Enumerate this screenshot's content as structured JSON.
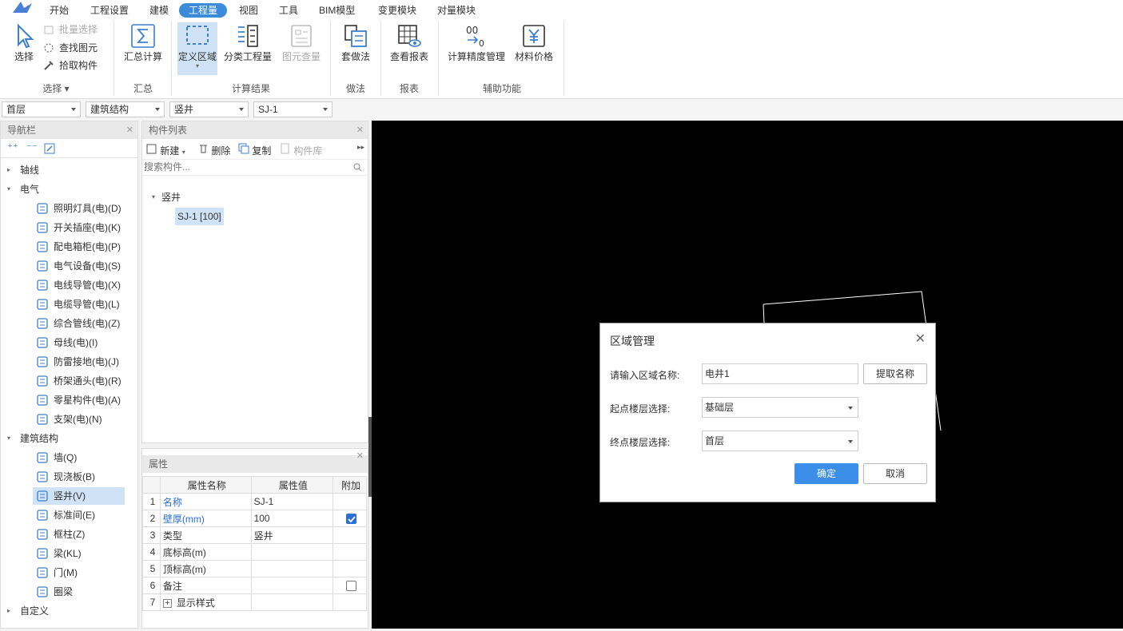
{
  "menu": {
    "items": [
      "开始",
      "工程设置",
      "建模",
      "工程量",
      "视图",
      "工具",
      "BIM模型",
      "变更模块",
      "对量模块"
    ],
    "active_index": 3
  },
  "ribbon": {
    "select": "选择",
    "batch_select": "批量选择",
    "find_element": "查找图元",
    "pick_component": "拾取构件",
    "sum_calc": "汇总计算",
    "define_region": "定义区域",
    "category_qty": "分类工程量",
    "element_qty": "图元查量",
    "apply_method": "套做法",
    "view_report": "查看报表",
    "precision_mgmt": "计算精度管理",
    "material_price": "材料价格",
    "groups": {
      "select": "选择",
      "summary": "汇总",
      "calc_result": "计算结果",
      "method": "做法",
      "report": "报表",
      "aux": "辅助功能"
    }
  },
  "combos": {
    "floor": "首层",
    "category": "建筑结构",
    "type": "竖井",
    "component": "SJ-1"
  },
  "nav": {
    "title": "导航栏",
    "items": [
      {
        "label": "轴线",
        "level": 0,
        "expanded": false
      },
      {
        "label": "电气",
        "level": 0,
        "expanded": true
      },
      {
        "label": "照明灯具(电)(D)",
        "level": 1
      },
      {
        "label": "开关插座(电)(K)",
        "level": 1
      },
      {
        "label": "配电箱柜(电)(P)",
        "level": 1
      },
      {
        "label": "电气设备(电)(S)",
        "level": 1
      },
      {
        "label": "电线导管(电)(X)",
        "level": 1
      },
      {
        "label": "电缆导管(电)(L)",
        "level": 1
      },
      {
        "label": "综合管线(电)(Z)",
        "level": 1
      },
      {
        "label": "母线(电)(I)",
        "level": 1
      },
      {
        "label": "防雷接地(电)(J)",
        "level": 1
      },
      {
        "label": "桥架通头(电)(R)",
        "level": 1
      },
      {
        "label": "零星构件(电)(A)",
        "level": 1
      },
      {
        "label": "支架(电)(N)",
        "level": 1
      },
      {
        "label": "建筑结构",
        "level": 0,
        "expanded": true
      },
      {
        "label": "墙(Q)",
        "level": 1
      },
      {
        "label": "现浇板(B)",
        "level": 1
      },
      {
        "label": "竖井(V)",
        "level": 1,
        "selected": true
      },
      {
        "label": "标准间(E)",
        "level": 1
      },
      {
        "label": "框柱(Z)",
        "level": 1
      },
      {
        "label": "梁(KL)",
        "level": 1
      },
      {
        "label": "门(M)",
        "level": 1
      },
      {
        "label": "圈梁",
        "level": 1
      },
      {
        "label": "自定义",
        "level": 0,
        "expanded": false
      }
    ]
  },
  "component_list": {
    "title": "构件列表",
    "new": "新建",
    "delete": "删除",
    "copy": "复制",
    "library": "构件库",
    "search_placeholder": "搜索构件...",
    "group": "竖井",
    "item": "SJ-1 [100]"
  },
  "properties": {
    "title": "属性",
    "headers": [
      "属性名称",
      "属性值",
      "附加"
    ],
    "rows": [
      {
        "no": "1",
        "name": "名称",
        "value": "SJ-1",
        "blue": true,
        "check": "none"
      },
      {
        "no": "2",
        "name": "壁厚(mm)",
        "value": "100",
        "blue": true,
        "check": "on"
      },
      {
        "no": "3",
        "name": "类型",
        "value": "竖井",
        "blue": false,
        "check": "none"
      },
      {
        "no": "4",
        "name": "底标高(m)",
        "value": "",
        "blue": false,
        "check": "none"
      },
      {
        "no": "5",
        "name": "顶标高(m)",
        "value": "",
        "blue": false,
        "check": "none"
      },
      {
        "no": "6",
        "name": "备注",
        "value": "",
        "blue": false,
        "check": "off"
      },
      {
        "no": "7",
        "name": "显示样式",
        "value": "",
        "blue": false,
        "check": "none",
        "expandable": true
      }
    ]
  },
  "dialog": {
    "title": "区域管理",
    "name_label": "请输入区域名称:",
    "name_value": "电井1",
    "extract_btn": "提取名称",
    "start_label": "起点楼层选择:",
    "start_value": "基础层",
    "end_label": "终点楼层选择:",
    "end_value": "首层",
    "ok": "确定",
    "cancel": "取消"
  },
  "colors": {
    "accent": "#3b8bdb",
    "canvas": "#000000",
    "selection": "#cfe2f6"
  }
}
